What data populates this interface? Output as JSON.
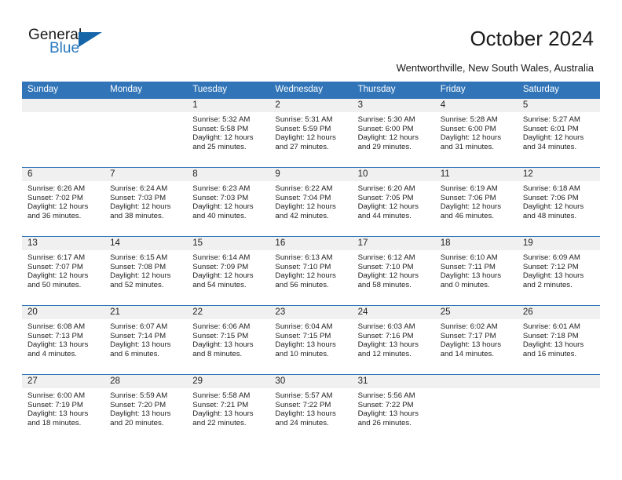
{
  "brand": {
    "name_part1": "General",
    "name_part2": "Blue",
    "accent_color": "#2a7ac0",
    "triangle_color": "#1565a8"
  },
  "header": {
    "title": "October 2024",
    "subtitle": "Wentworthville, New South Wales, Australia",
    "header_bg_color": "#3175b8",
    "daystrip_bg_color": "#f0f0f0"
  },
  "weekdays": [
    "Sunday",
    "Monday",
    "Tuesday",
    "Wednesday",
    "Thursday",
    "Friday",
    "Saturday"
  ],
  "weeks": [
    [
      {
        "day": "",
        "sunrise": "",
        "sunset": "",
        "daylight_line1": "",
        "daylight_line2": ""
      },
      {
        "day": "",
        "sunrise": "",
        "sunset": "",
        "daylight_line1": "",
        "daylight_line2": ""
      },
      {
        "day": "1",
        "sunrise": "Sunrise: 5:32 AM",
        "sunset": "Sunset: 5:58 PM",
        "daylight_line1": "Daylight: 12 hours",
        "daylight_line2": "and 25 minutes."
      },
      {
        "day": "2",
        "sunrise": "Sunrise: 5:31 AM",
        "sunset": "Sunset: 5:59 PM",
        "daylight_line1": "Daylight: 12 hours",
        "daylight_line2": "and 27 minutes."
      },
      {
        "day": "3",
        "sunrise": "Sunrise: 5:30 AM",
        "sunset": "Sunset: 6:00 PM",
        "daylight_line1": "Daylight: 12 hours",
        "daylight_line2": "and 29 minutes."
      },
      {
        "day": "4",
        "sunrise": "Sunrise: 5:28 AM",
        "sunset": "Sunset: 6:00 PM",
        "daylight_line1": "Daylight: 12 hours",
        "daylight_line2": "and 31 minutes."
      },
      {
        "day": "5",
        "sunrise": "Sunrise: 5:27 AM",
        "sunset": "Sunset: 6:01 PM",
        "daylight_line1": "Daylight: 12 hours",
        "daylight_line2": "and 34 minutes."
      }
    ],
    [
      {
        "day": "6",
        "sunrise": "Sunrise: 6:26 AM",
        "sunset": "Sunset: 7:02 PM",
        "daylight_line1": "Daylight: 12 hours",
        "daylight_line2": "and 36 minutes."
      },
      {
        "day": "7",
        "sunrise": "Sunrise: 6:24 AM",
        "sunset": "Sunset: 7:03 PM",
        "daylight_line1": "Daylight: 12 hours",
        "daylight_line2": "and 38 minutes."
      },
      {
        "day": "8",
        "sunrise": "Sunrise: 6:23 AM",
        "sunset": "Sunset: 7:03 PM",
        "daylight_line1": "Daylight: 12 hours",
        "daylight_line2": "and 40 minutes."
      },
      {
        "day": "9",
        "sunrise": "Sunrise: 6:22 AM",
        "sunset": "Sunset: 7:04 PM",
        "daylight_line1": "Daylight: 12 hours",
        "daylight_line2": "and 42 minutes."
      },
      {
        "day": "10",
        "sunrise": "Sunrise: 6:20 AM",
        "sunset": "Sunset: 7:05 PM",
        "daylight_line1": "Daylight: 12 hours",
        "daylight_line2": "and 44 minutes."
      },
      {
        "day": "11",
        "sunrise": "Sunrise: 6:19 AM",
        "sunset": "Sunset: 7:06 PM",
        "daylight_line1": "Daylight: 12 hours",
        "daylight_line2": "and 46 minutes."
      },
      {
        "day": "12",
        "sunrise": "Sunrise: 6:18 AM",
        "sunset": "Sunset: 7:06 PM",
        "daylight_line1": "Daylight: 12 hours",
        "daylight_line2": "and 48 minutes."
      }
    ],
    [
      {
        "day": "13",
        "sunrise": "Sunrise: 6:17 AM",
        "sunset": "Sunset: 7:07 PM",
        "daylight_line1": "Daylight: 12 hours",
        "daylight_line2": "and 50 minutes."
      },
      {
        "day": "14",
        "sunrise": "Sunrise: 6:15 AM",
        "sunset": "Sunset: 7:08 PM",
        "daylight_line1": "Daylight: 12 hours",
        "daylight_line2": "and 52 minutes."
      },
      {
        "day": "15",
        "sunrise": "Sunrise: 6:14 AM",
        "sunset": "Sunset: 7:09 PM",
        "daylight_line1": "Daylight: 12 hours",
        "daylight_line2": "and 54 minutes."
      },
      {
        "day": "16",
        "sunrise": "Sunrise: 6:13 AM",
        "sunset": "Sunset: 7:10 PM",
        "daylight_line1": "Daylight: 12 hours",
        "daylight_line2": "and 56 minutes."
      },
      {
        "day": "17",
        "sunrise": "Sunrise: 6:12 AM",
        "sunset": "Sunset: 7:10 PM",
        "daylight_line1": "Daylight: 12 hours",
        "daylight_line2": "and 58 minutes."
      },
      {
        "day": "18",
        "sunrise": "Sunrise: 6:10 AM",
        "sunset": "Sunset: 7:11 PM",
        "daylight_line1": "Daylight: 13 hours",
        "daylight_line2": "and 0 minutes."
      },
      {
        "day": "19",
        "sunrise": "Sunrise: 6:09 AM",
        "sunset": "Sunset: 7:12 PM",
        "daylight_line1": "Daylight: 13 hours",
        "daylight_line2": "and 2 minutes."
      }
    ],
    [
      {
        "day": "20",
        "sunrise": "Sunrise: 6:08 AM",
        "sunset": "Sunset: 7:13 PM",
        "daylight_line1": "Daylight: 13 hours",
        "daylight_line2": "and 4 minutes."
      },
      {
        "day": "21",
        "sunrise": "Sunrise: 6:07 AM",
        "sunset": "Sunset: 7:14 PM",
        "daylight_line1": "Daylight: 13 hours",
        "daylight_line2": "and 6 minutes."
      },
      {
        "day": "22",
        "sunrise": "Sunrise: 6:06 AM",
        "sunset": "Sunset: 7:15 PM",
        "daylight_line1": "Daylight: 13 hours",
        "daylight_line2": "and 8 minutes."
      },
      {
        "day": "23",
        "sunrise": "Sunrise: 6:04 AM",
        "sunset": "Sunset: 7:15 PM",
        "daylight_line1": "Daylight: 13 hours",
        "daylight_line2": "and 10 minutes."
      },
      {
        "day": "24",
        "sunrise": "Sunrise: 6:03 AM",
        "sunset": "Sunset: 7:16 PM",
        "daylight_line1": "Daylight: 13 hours",
        "daylight_line2": "and 12 minutes."
      },
      {
        "day": "25",
        "sunrise": "Sunrise: 6:02 AM",
        "sunset": "Sunset: 7:17 PM",
        "daylight_line1": "Daylight: 13 hours",
        "daylight_line2": "and 14 minutes."
      },
      {
        "day": "26",
        "sunrise": "Sunrise: 6:01 AM",
        "sunset": "Sunset: 7:18 PM",
        "daylight_line1": "Daylight: 13 hours",
        "daylight_line2": "and 16 minutes."
      }
    ],
    [
      {
        "day": "27",
        "sunrise": "Sunrise: 6:00 AM",
        "sunset": "Sunset: 7:19 PM",
        "daylight_line1": "Daylight: 13 hours",
        "daylight_line2": "and 18 minutes."
      },
      {
        "day": "28",
        "sunrise": "Sunrise: 5:59 AM",
        "sunset": "Sunset: 7:20 PM",
        "daylight_line1": "Daylight: 13 hours",
        "daylight_line2": "and 20 minutes."
      },
      {
        "day": "29",
        "sunrise": "Sunrise: 5:58 AM",
        "sunset": "Sunset: 7:21 PM",
        "daylight_line1": "Daylight: 13 hours",
        "daylight_line2": "and 22 minutes."
      },
      {
        "day": "30",
        "sunrise": "Sunrise: 5:57 AM",
        "sunset": "Sunset: 7:22 PM",
        "daylight_line1": "Daylight: 13 hours",
        "daylight_line2": "and 24 minutes."
      },
      {
        "day": "31",
        "sunrise": "Sunrise: 5:56 AM",
        "sunset": "Sunset: 7:22 PM",
        "daylight_line1": "Daylight: 13 hours",
        "daylight_line2": "and 26 minutes."
      },
      {
        "day": "",
        "sunrise": "",
        "sunset": "",
        "daylight_line1": "",
        "daylight_line2": ""
      },
      {
        "day": "",
        "sunrise": "",
        "sunset": "",
        "daylight_line1": "",
        "daylight_line2": ""
      }
    ]
  ]
}
